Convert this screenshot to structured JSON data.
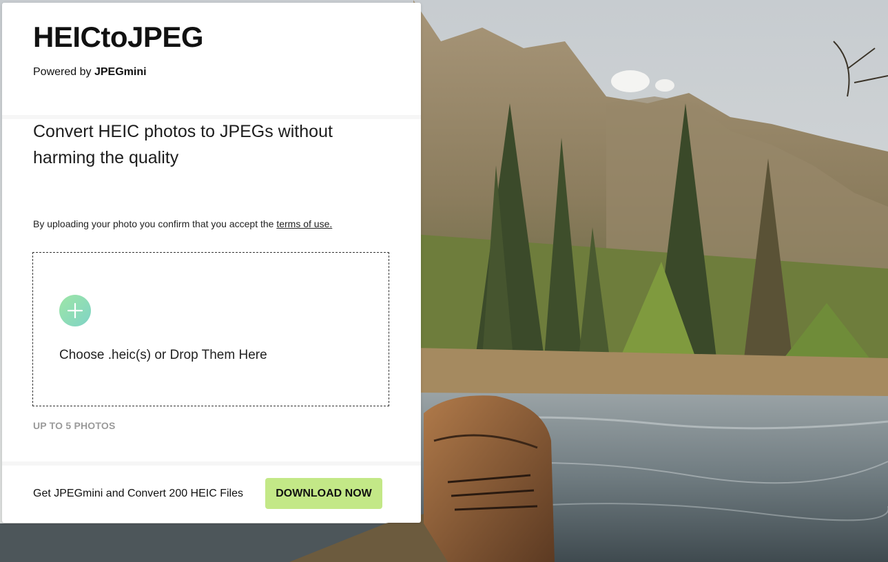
{
  "header": {
    "logo_text": "HEICtoJPEG",
    "powered_prefix": "Powered by",
    "powered_brand": "JPEGmini"
  },
  "main": {
    "headline": "Convert HEIC photos to JPEGs without harming the quality",
    "consent_text": "By uploading your photo you confirm that you accept the",
    "terms_link": "terms of use.",
    "dropzone_text": "Choose .heic(s) or Drop Them Here",
    "upload_icon": "plus-icon",
    "limit_text": "UP TO 5 PHOTOS"
  },
  "footer": {
    "promo_text": "Get JPEGmini and Convert 200 HEIC Files",
    "download_label": "DOWNLOAD NOW"
  },
  "colors": {
    "accent_green": "#c3e887",
    "plus_gradient_start": "#9ee6a6",
    "plus_gradient_end": "#7fd3c6",
    "muted_text": "#9a9a9a"
  }
}
